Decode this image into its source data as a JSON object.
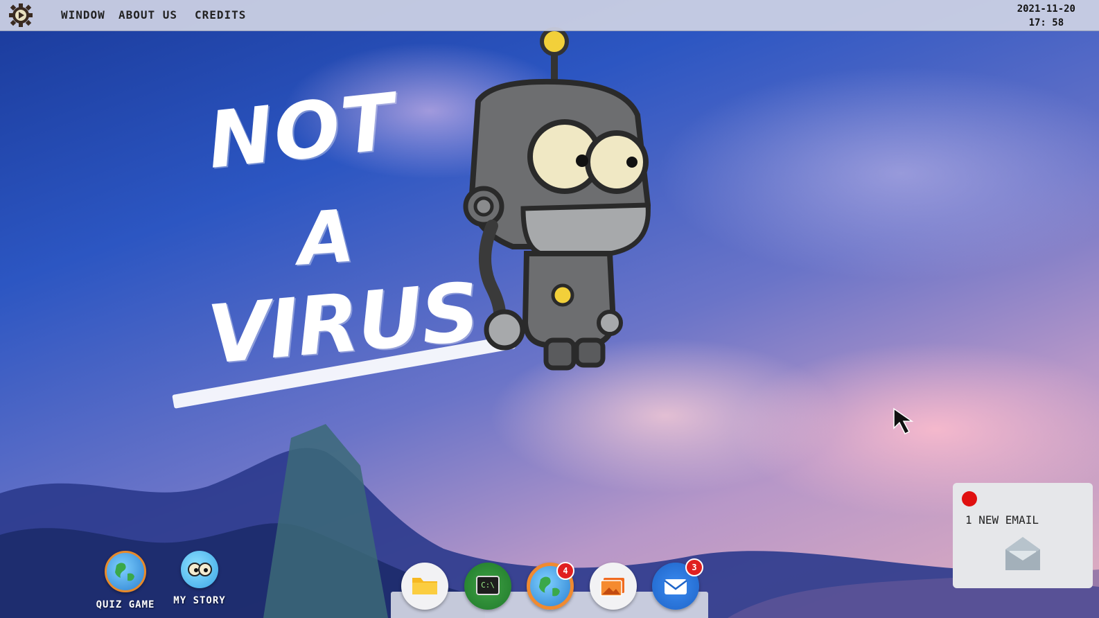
{
  "menubar": {
    "logo": "gear-logo-icon",
    "items": [
      "WINDOW",
      "ABOUT US",
      "CREDITS"
    ],
    "date": "2021-11-20",
    "time": "17: 58"
  },
  "wallpaper": {
    "title_lines": [
      "NOT",
      "A",
      "VIRUS"
    ],
    "mascot": "robot-icon"
  },
  "desktop_icons": [
    {
      "label": "QUIZ GAME",
      "icon": "globe-icon"
    },
    {
      "label": "MY STORY",
      "icon": "eyes-icon"
    }
  ],
  "dock": [
    {
      "icon": "folder-icon",
      "badge": ""
    },
    {
      "icon": "terminal-icon",
      "text": "C:\\",
      "badge": ""
    },
    {
      "icon": "globe-icon",
      "badge": "4"
    },
    {
      "icon": "photos-icon",
      "badge": ""
    },
    {
      "icon": "mail-icon",
      "badge": "3"
    }
  ],
  "notification": {
    "text": "1 NEW EMAIL",
    "icon": "envelope-icon",
    "status_color": "#e01010"
  },
  "colors": {
    "menubar_bg": "#cdd2e4",
    "accent_red": "#e02020"
  }
}
